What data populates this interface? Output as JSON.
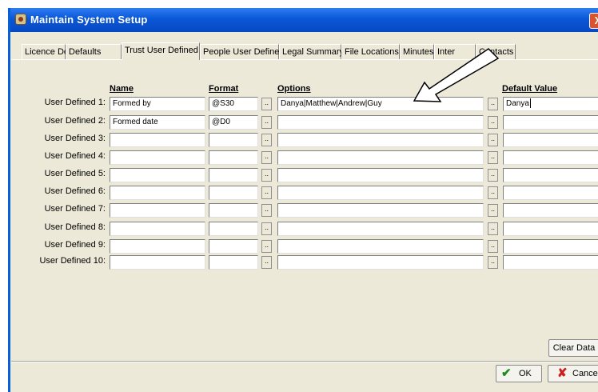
{
  "window": {
    "title": "Maintain System Setup",
    "close_glyph": "X"
  },
  "tabs": [
    {
      "label": "Licence Details"
    },
    {
      "label": "Defaults"
    },
    {
      "label": "Trust User Defined",
      "active": true
    },
    {
      "label": "People User Defined"
    },
    {
      "label": "Legal Summary"
    },
    {
      "label": "File Locations"
    },
    {
      "label": "Minutes"
    },
    {
      "label": "Inter"
    },
    {
      "label": "Contacts"
    }
  ],
  "columns": {
    "name": "Name",
    "format": "Format",
    "options": "Options",
    "default_value": "Default Value"
  },
  "rows": [
    {
      "label": "User Defined 1:",
      "name": "Formed by",
      "format": "@S30",
      "options": "Danya|Matthew|Andrew|Guy",
      "default": "Danya"
    },
    {
      "label": "User Defined 2:",
      "name": "Formed date",
      "format": "@D0",
      "options": "",
      "default": ""
    },
    {
      "label": "User Defined 3:",
      "name": "",
      "format": "",
      "options": "",
      "default": ""
    },
    {
      "label": "User Defined 4:",
      "name": "",
      "format": "",
      "options": "",
      "default": ""
    },
    {
      "label": "User Defined 5:",
      "name": "",
      "format": "",
      "options": "",
      "default": ""
    },
    {
      "label": "User Defined 6:",
      "name": "",
      "format": "",
      "options": "",
      "default": ""
    },
    {
      "label": "User Defined 7:",
      "name": "",
      "format": "",
      "options": "",
      "default": ""
    },
    {
      "label": "User Defined 8:",
      "name": "",
      "format": "",
      "options": "",
      "default": ""
    },
    {
      "label": "User Defined 9:",
      "name": "",
      "format": "",
      "options": "",
      "default": ""
    },
    {
      "label": "User Defined 10:",
      "name": "",
      "format": "",
      "options": "",
      "default": ""
    }
  ],
  "ellipsis_label": "..",
  "buttons": {
    "clear_data": "Clear Data",
    "ok": "OK",
    "cancel": "Cancel"
  },
  "colors": {
    "titlebar": "#0a57d7",
    "window_bg": "#ece9d8",
    "ok_check": "#1f8a1f",
    "cancel_x": "#cc1f1f"
  }
}
